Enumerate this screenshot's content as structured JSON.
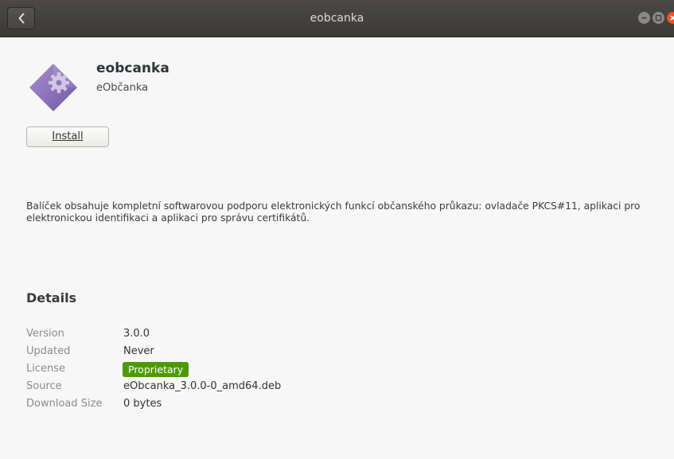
{
  "window": {
    "title": "eobcanka"
  },
  "app": {
    "name": "eobcanka",
    "summary": "eObčanka",
    "icon": "diamond-app-icon",
    "install_label": "Install",
    "description": "Balíček obsahuje kompletní softwarovou podporu elektronických funkcí občanského průkazu: ovladače PKCS#11, aplikaci pro elektronickou identifikaci a aplikaci pro správu certifikátů."
  },
  "details": {
    "heading": "Details",
    "rows": [
      {
        "label": "Version",
        "value": "3.0.0"
      },
      {
        "label": "Updated",
        "value": "Never"
      },
      {
        "label": "License",
        "value": "Proprietary"
      },
      {
        "label": "Source",
        "value": "eObcanka_3.0.0-0_amd64.deb"
      },
      {
        "label": "Download Size",
        "value": "0 bytes"
      }
    ]
  },
  "colors": {
    "titlebar": "#3f3e3a",
    "close_button": "#e95420",
    "license_badge": "#4e9a06"
  }
}
